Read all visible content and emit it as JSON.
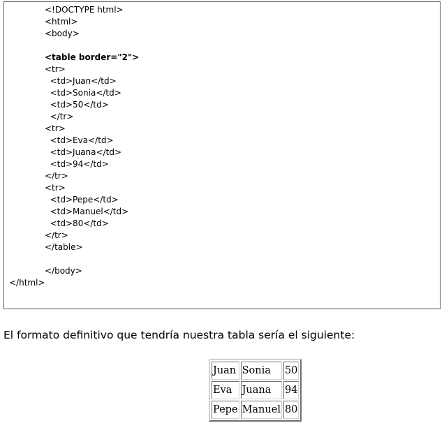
{
  "code": {
    "lines": [
      "<!DOCTYPE html>",
      "<html>",
      "<body>",
      "",
      "<table border=\"2\">",
      "<tr>",
      "  <td>Juan</td>",
      "  <td>Sonia</td>",
      "  <td>50</td>",
      "  </tr>",
      "<tr>",
      "  <td>Eva</td>",
      "  <td>Juana</td>",
      "  <td>94</td>",
      "</tr>",
      "<tr>",
      "  <td>Pepe</td>",
      "  <td>Manuel</td>",
      "  <td>80</td>",
      "</tr>",
      "</table>",
      "",
      "</body>",
      "</html>"
    ]
  },
  "caption": "El formato definitivo que tendría nuestra tabla sería el siguiente:",
  "result_table": {
    "rows": [
      [
        "Juan",
        "Sonia",
        "50"
      ],
      [
        "Eva",
        "Juana",
        "94"
      ],
      [
        "Pepe",
        "Manuel",
        "80"
      ]
    ]
  }
}
